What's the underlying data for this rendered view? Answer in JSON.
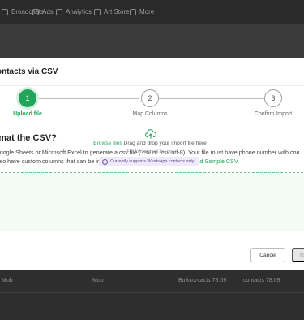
{
  "background": {
    "nav_items": [
      {
        "label": "Broadcasts",
        "icon": "broadcast-icon"
      },
      {
        "label": "Ads",
        "icon": "ads-icon"
      },
      {
        "label": "Analytics",
        "icon": "analytics-icon"
      },
      {
        "label": "Art Store",
        "icon": "store-icon"
      },
      {
        "label": "More",
        "icon": "more-icon"
      }
    ],
    "bottom_row": {
      "col1": "Mob",
      "col2": "Mob",
      "col3": "Bulkcontacts 78.09",
      "col4": "contacts 78.09"
    }
  },
  "modal": {
    "title": "ontacts via CSV",
    "steps": [
      {
        "number": "1",
        "label": "Upload file",
        "active": true
      },
      {
        "number": "2",
        "label": "Map Columns",
        "active": false
      },
      {
        "number": "3",
        "label": "Confirm Import",
        "active": false
      }
    ],
    "section_title": "rmat the CSV?",
    "description": {
      "line1": "Google Sheets or Microsoft Excel to generate a csv file (.csv or .csv utf-8). Your file must have phone number with cou",
      "line2_prefix": "also have custom columns that can be imported to WATI as attributes. ",
      "link": "Download Sample CSV."
    },
    "dropzone": {
      "icon": "cloud-upload-icon",
      "browse_link": "Browse files",
      "drag_text": " Drag and drop your import file here",
      "file_format": "File format must be .csv",
      "support_note": "Currently supports WhatsApp contacts only"
    },
    "buttons": {
      "cancel": "Cancel",
      "next": "N"
    }
  },
  "colors": {
    "accent": "#22a55b",
    "overlay": "#3c3c3c",
    "badge_bg": "#efe9fb"
  }
}
